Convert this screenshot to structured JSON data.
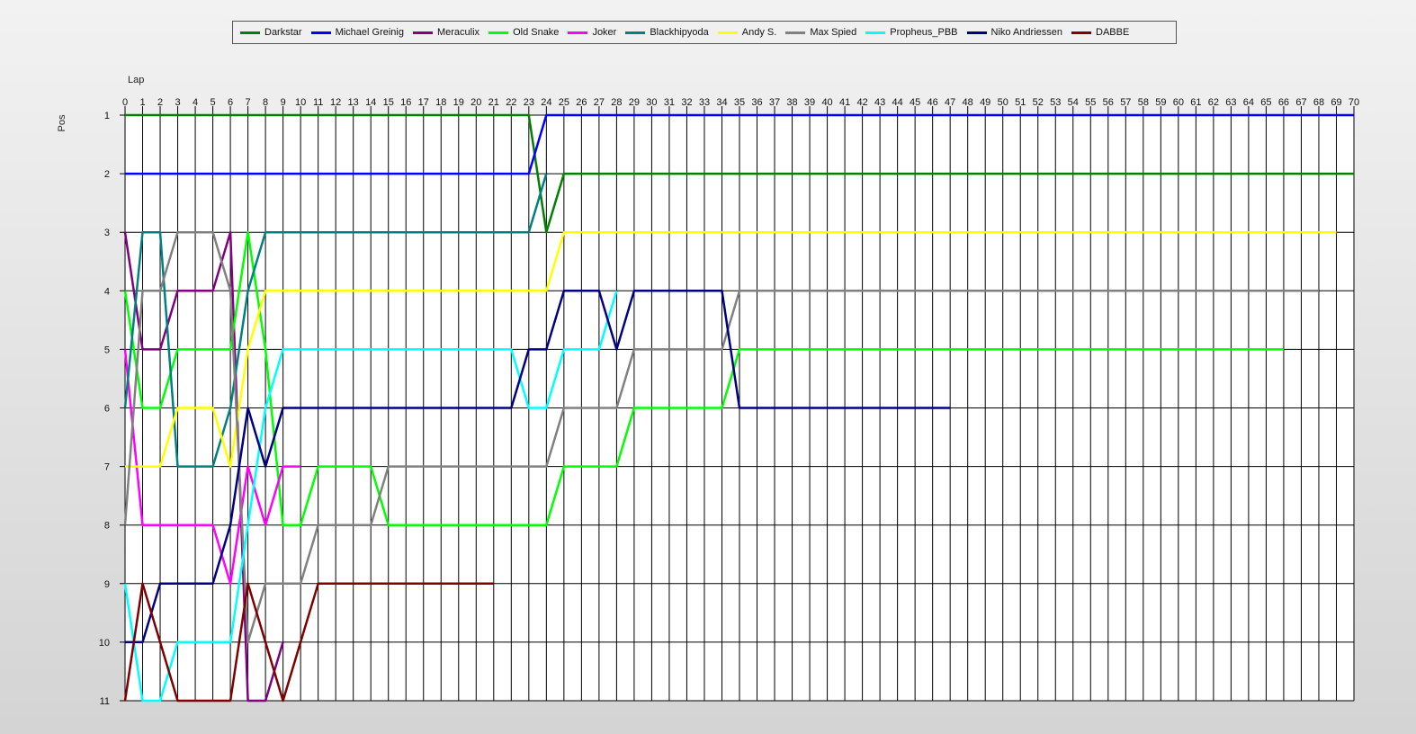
{
  "chart_data": {
    "type": "line",
    "xlabel": "Lap",
    "ylabel": "Pos",
    "xlim": [
      0,
      70
    ],
    "ylim": [
      1,
      11
    ],
    "y_inverted": true,
    "grid": true,
    "legend_position": "top",
    "x_ticks": [
      0,
      1,
      2,
      3,
      4,
      5,
      6,
      7,
      8,
      9,
      10,
      11,
      12,
      13,
      14,
      15,
      16,
      17,
      18,
      19,
      20,
      21,
      22,
      23,
      24,
      25,
      26,
      27,
      28,
      29,
      30,
      31,
      32,
      33,
      34,
      35,
      36,
      37,
      38,
      39,
      40,
      41,
      42,
      43,
      44,
      45,
      46,
      47,
      48,
      49,
      50,
      51,
      52,
      53,
      54,
      55,
      56,
      57,
      58,
      59,
      60,
      61,
      62,
      63,
      64,
      65,
      66,
      67,
      68,
      69,
      70
    ],
    "y_ticks": [
      1,
      2,
      3,
      4,
      5,
      6,
      7,
      8,
      9,
      10,
      11
    ],
    "series": [
      {
        "name": "Darkstar",
        "color": "#008000",
        "points": [
          [
            0,
            1
          ],
          [
            23,
            1
          ],
          [
            24,
            3
          ],
          [
            25,
            2
          ],
          [
            70,
            2
          ]
        ]
      },
      {
        "name": "Michael Greinig",
        "color": "#0000ff",
        "points": [
          [
            0,
            2
          ],
          [
            23,
            2
          ],
          [
            24,
            1
          ],
          [
            70,
            1
          ]
        ]
      },
      {
        "name": "Meraculix",
        "color": "#800080",
        "points": [
          [
            0,
            3
          ],
          [
            1,
            5
          ],
          [
            2,
            5
          ],
          [
            3,
            4
          ],
          [
            5,
            4
          ],
          [
            6,
            3
          ],
          [
            7,
            11
          ],
          [
            8,
            11
          ],
          [
            9,
            10
          ]
        ]
      },
      {
        "name": "Old Snake",
        "color": "#00ff00",
        "points": [
          [
            0,
            4
          ],
          [
            1,
            6
          ],
          [
            2,
            6
          ],
          [
            3,
            5
          ],
          [
            6,
            5
          ],
          [
            7,
            3
          ],
          [
            8,
            5
          ],
          [
            9,
            8
          ],
          [
            10,
            8
          ],
          [
            11,
            7
          ],
          [
            14,
            7
          ],
          [
            15,
            8
          ],
          [
            24,
            8
          ],
          [
            25,
            7
          ],
          [
            28,
            7
          ],
          [
            29,
            6
          ],
          [
            34,
            6
          ],
          [
            35,
            5
          ],
          [
            66,
            5
          ]
        ]
      },
      {
        "name": "Joker",
        "color": "#ff00ff",
        "points": [
          [
            0,
            5
          ],
          [
            1,
            8
          ],
          [
            5,
            8
          ],
          [
            6,
            9
          ],
          [
            7,
            7
          ],
          [
            8,
            8
          ],
          [
            9,
            7
          ],
          [
            10,
            7
          ]
        ]
      },
      {
        "name": "Blackhipyoda",
        "color": "#008080",
        "points": [
          [
            0,
            6
          ],
          [
            1,
            3
          ],
          [
            2,
            3
          ],
          [
            3,
            7
          ],
          [
            5,
            7
          ],
          [
            6,
            6
          ],
          [
            7,
            4
          ],
          [
            8,
            3
          ],
          [
            23,
            3
          ],
          [
            24,
            2
          ]
        ]
      },
      {
        "name": "Andy S.",
        "color": "#ffff00",
        "points": [
          [
            0,
            7
          ],
          [
            2,
            7
          ],
          [
            3,
            6
          ],
          [
            5,
            6
          ],
          [
            6,
            7
          ],
          [
            7,
            5
          ],
          [
            8,
            4
          ],
          [
            24,
            4
          ],
          [
            25,
            3
          ],
          [
            69,
            3
          ]
        ]
      },
      {
        "name": "Max Spied",
        "color": "#808080",
        "points": [
          [
            0,
            8
          ],
          [
            1,
            4
          ],
          [
            2,
            4
          ],
          [
            3,
            3
          ],
          [
            5,
            3
          ],
          [
            6,
            4
          ],
          [
            7,
            10
          ],
          [
            8,
            9
          ],
          [
            10,
            9
          ],
          [
            11,
            8
          ],
          [
            14,
            8
          ],
          [
            15,
            7
          ],
          [
            24,
            7
          ],
          [
            25,
            6
          ],
          [
            28,
            6
          ],
          [
            29,
            5
          ],
          [
            34,
            5
          ],
          [
            35,
            4
          ],
          [
            68,
            4
          ]
        ]
      },
      {
        "name": "Propheus_PBB",
        "color": "#00ffff",
        "points": [
          [
            0,
            9
          ],
          [
            1,
            11
          ],
          [
            2,
            11
          ],
          [
            3,
            10
          ],
          [
            6,
            10
          ],
          [
            7,
            8
          ],
          [
            8,
            6
          ],
          [
            9,
            5
          ],
          [
            22,
            5
          ],
          [
            23,
            6
          ],
          [
            24,
            6
          ],
          [
            25,
            5
          ],
          [
            27,
            5
          ],
          [
            28,
            4
          ]
        ]
      },
      {
        "name": "Niko Andriessen",
        "color": "#000080",
        "points": [
          [
            0,
            10
          ],
          [
            1,
            10
          ],
          [
            2,
            9
          ],
          [
            5,
            9
          ],
          [
            6,
            8
          ],
          [
            7,
            6
          ],
          [
            8,
            7
          ],
          [
            9,
            6
          ],
          [
            22,
            6
          ],
          [
            23,
            5
          ],
          [
            24,
            5
          ],
          [
            25,
            4
          ],
          [
            27,
            4
          ],
          [
            28,
            5
          ],
          [
            29,
            4
          ],
          [
            34,
            4
          ],
          [
            35,
            6
          ],
          [
            47,
            6
          ]
        ]
      },
      {
        "name": "DABBE",
        "color": "#800000",
        "points": [
          [
            0,
            11
          ],
          [
            1,
            9
          ],
          [
            2,
            10
          ],
          [
            3,
            11
          ],
          [
            6,
            11
          ],
          [
            7,
            9
          ],
          [
            8,
            10
          ],
          [
            9,
            11
          ],
          [
            10,
            10
          ],
          [
            11,
            9
          ],
          [
            21,
            9
          ]
        ]
      }
    ]
  }
}
